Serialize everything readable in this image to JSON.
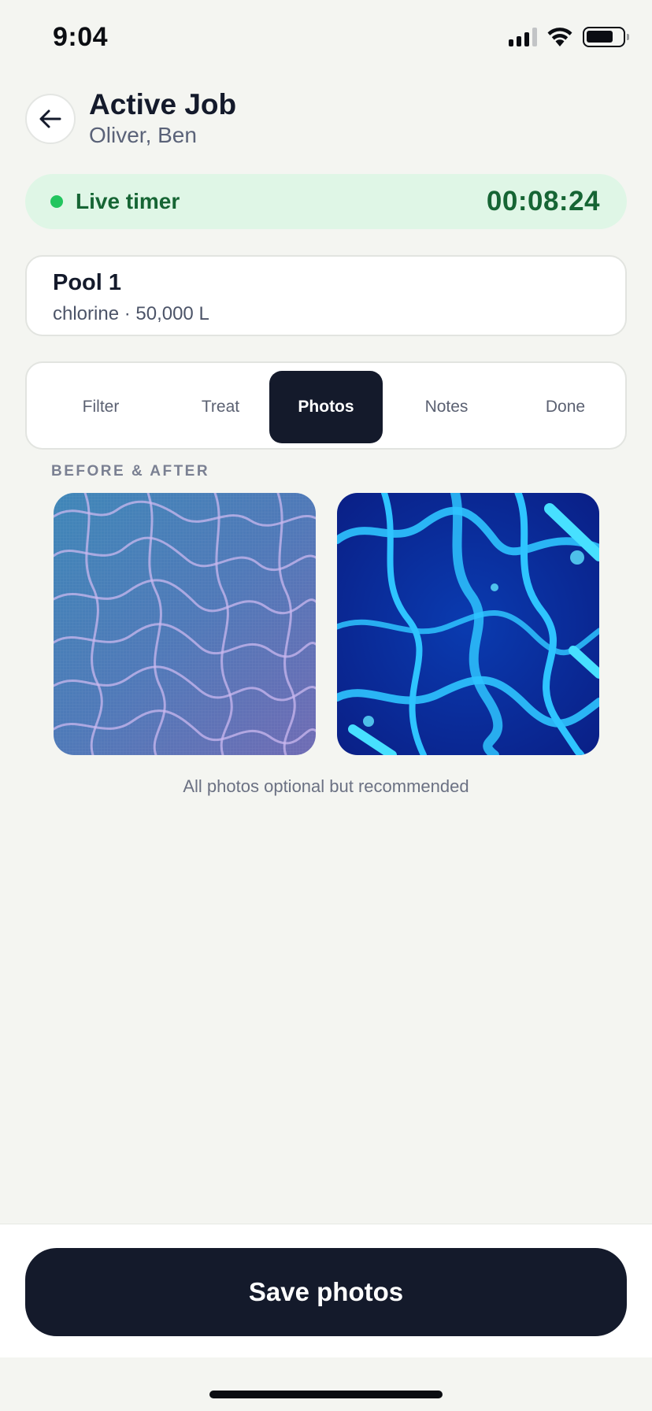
{
  "status_bar": {
    "time": "9:04"
  },
  "header": {
    "title": "Active Job",
    "subtitle": "Oliver, Ben"
  },
  "timer": {
    "label": "Live timer",
    "value": "00:08:24",
    "status_color": "#22c55e"
  },
  "pool": {
    "name": "Pool 1",
    "meta": "chlorine · 50,000 L"
  },
  "tabs": [
    {
      "label": "Filter",
      "active": false
    },
    {
      "label": "Treat",
      "active": false
    },
    {
      "label": "Photos",
      "active": true
    },
    {
      "label": "Notes",
      "active": false
    },
    {
      "label": "Done",
      "active": false
    }
  ],
  "photos": {
    "section_label": "BEFORE & AFTER",
    "hint": "All photos optional but recommended"
  },
  "footer": {
    "save_label": "Save photos"
  },
  "colors": {
    "primary_dark": "#141a2b",
    "accent_green": "#166534",
    "timer_bg": "#dff6e6"
  }
}
